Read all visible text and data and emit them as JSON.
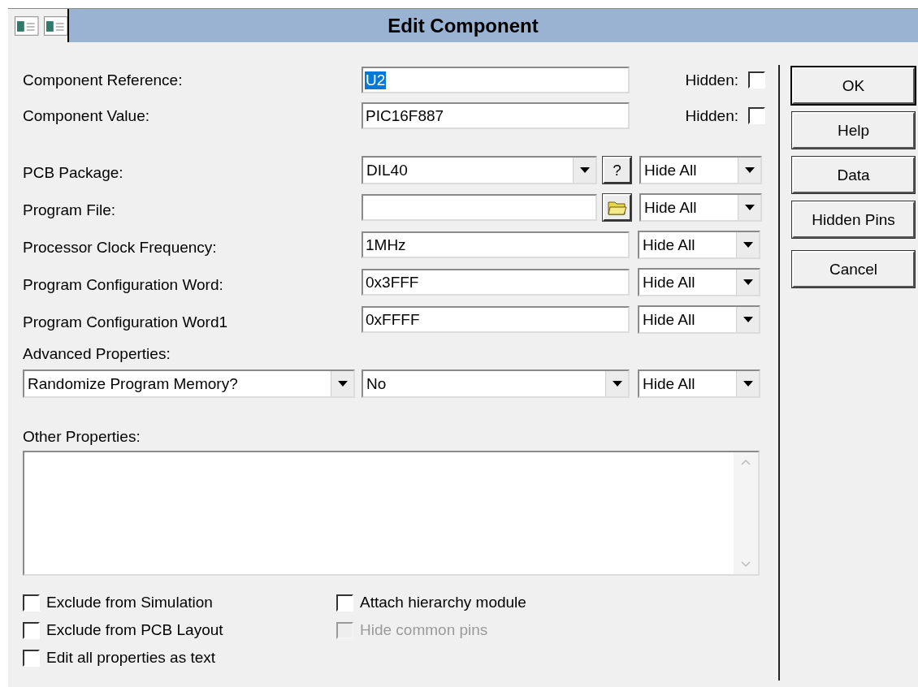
{
  "title": "Edit Component",
  "top_fields": [
    {
      "label": "Component Reference:",
      "value": "U2",
      "selected": true,
      "hidden_label": "Hidden:",
      "hidden": false
    },
    {
      "label": "Component Value:",
      "value": "PIC16F887",
      "selected": false,
      "hidden_label": "Hidden:",
      "hidden": false
    }
  ],
  "properties": [
    {
      "kind": "combo",
      "label": "PCB Package:",
      "value": "DIL40",
      "help_button": "?",
      "visibility": "Hide All"
    },
    {
      "kind": "file",
      "label": "Program File:",
      "visibility": "Hide All"
    },
    {
      "kind": "text",
      "label": "Processor Clock Frequency:",
      "value": "1MHz",
      "visibility": "Hide All"
    },
    {
      "kind": "text",
      "label": "Program Configuration Word:",
      "value": "0x3FFF",
      "visibility": "Hide All"
    },
    {
      "kind": "text",
      "label": "Program Configuration Word1",
      "value": "0xFFFF",
      "visibility": "Hide All"
    }
  ],
  "advanced": {
    "label": "Advanced Properties:",
    "property": "Randomize Program Memory?",
    "value": "No",
    "visibility": "Hide All"
  },
  "other_properties": {
    "label": "Other Properties:"
  },
  "options_left": [
    {
      "label": "Exclude from Simulation",
      "checked": false,
      "disabled": false
    },
    {
      "label": "Exclude from PCB Layout",
      "checked": false,
      "disabled": false
    },
    {
      "label": "Edit all properties as text",
      "checked": false,
      "disabled": false
    }
  ],
  "options_right": [
    {
      "label": "Attach hierarchy module",
      "checked": false,
      "disabled": false
    },
    {
      "label": "Hide common pins",
      "checked": false,
      "disabled": true
    }
  ],
  "buttons": [
    {
      "label": "OK",
      "default": true
    },
    {
      "label": "Help",
      "default": false
    },
    {
      "label": "Data",
      "default": false
    },
    {
      "label": "Hidden Pins",
      "default": false
    },
    {
      "label": "Cancel",
      "default": false
    }
  ]
}
